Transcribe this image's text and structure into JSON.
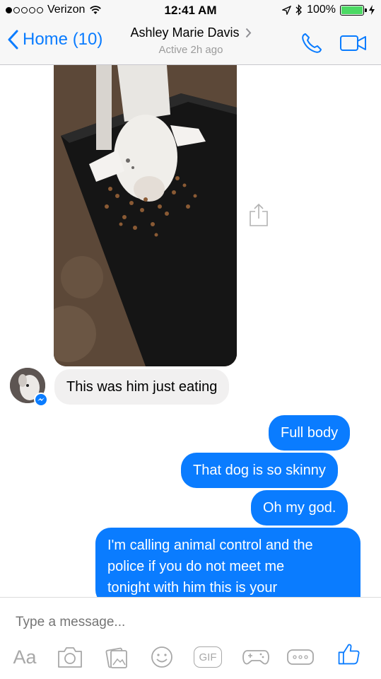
{
  "status_bar": {
    "carrier": "Verizon",
    "time": "12:41 AM",
    "battery": "100%",
    "signal_bars": 1
  },
  "nav": {
    "back_label": "Home (10)",
    "contact_name": "Ashley Marie Davis",
    "contact_status": "Active 2h ago"
  },
  "messages": [
    {
      "direction": "in",
      "text": "This was him just eating"
    },
    {
      "direction": "out",
      "text": "Full body"
    },
    {
      "direction": "out",
      "text": "That dog is so skinny"
    },
    {
      "direction": "out",
      "text": "Oh my god."
    },
    {
      "direction": "out",
      "lines": [
        "I'm calling animal control and the",
        "police if you do not meet me",
        "tonight with him this is your"
      ]
    }
  ],
  "composer": {
    "placeholder": "Type a message...",
    "aa_label": "Aa",
    "gif_label": "GIF",
    "tools": [
      "text-format-icon",
      "camera-icon",
      "gallery-icon",
      "emoji-icon",
      "gif-icon",
      "games-icon",
      "more-icon",
      "like-icon"
    ]
  },
  "colors": {
    "accent": "#0a7cff",
    "incoming_bubble": "#f1f0f0",
    "battery_fill": "#4cd964",
    "muted": "#9b9b9b"
  }
}
